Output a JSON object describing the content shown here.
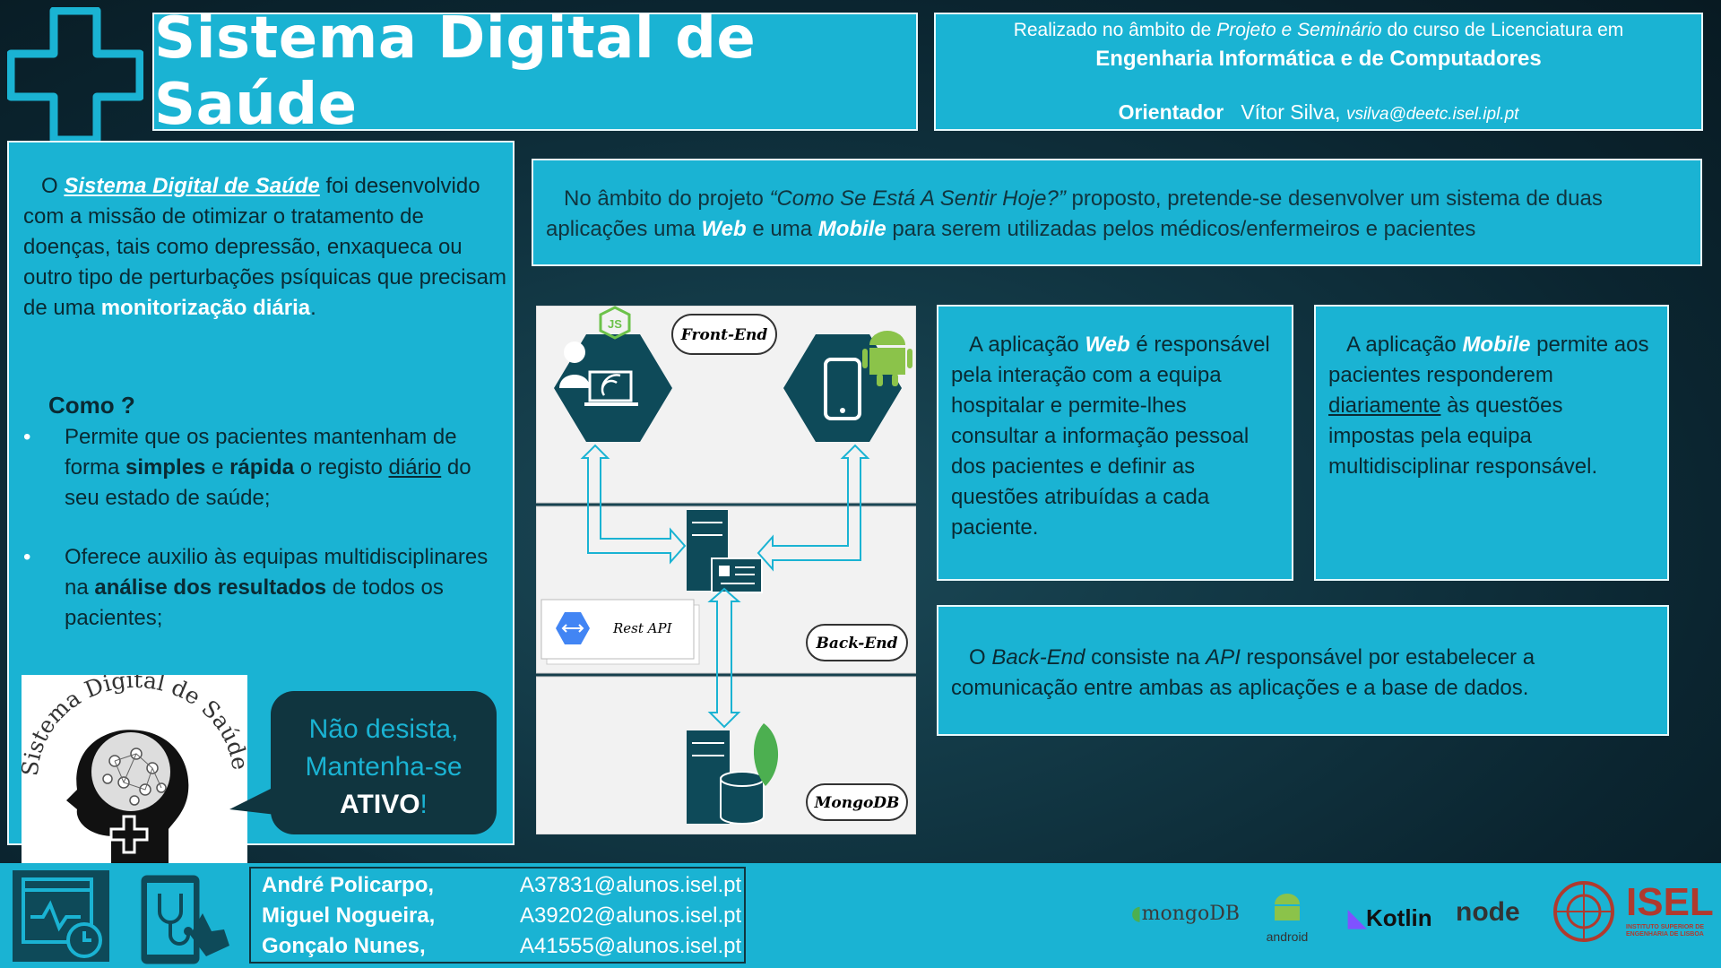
{
  "header": {
    "title": "Sistema Digital de Saúde",
    "info_prefix": "Realizado no âmbito de ",
    "info_course_italic": "Projeto e Seminário",
    "info_suffix": " do curso de Licenciatura em",
    "degree": "Engenharia Informática e de Computadores",
    "advisor_label": "Orientador",
    "advisor_name": "Vítor Silva,",
    "advisor_email": "vsilva@deetc.isel.ipl.pt"
  },
  "left": {
    "intro_pre": "O ",
    "intro_link": "Sistema Digital de Saúde",
    "intro_mid": " foi desenvolvido com a missão de otimizar o tratamento de doenças, tais como depressão, enxaqueca ou outro tipo de perturbações psíquicas que precisam de uma ",
    "intro_bold": "monitorização diária",
    "intro_end": ".",
    "como": "Como ?",
    "bullet_symbol": "•",
    "b1_a": "Permite que os pacientes mantenham de forma ",
    "b1_bold1": "simples",
    "b1_b": " e ",
    "b1_bold2": "rápida",
    "b1_c": " o registo ",
    "b1_under": "diário",
    "b1_d": " do seu estado de saúde;",
    "b2_a": "Oferece auxilio às equipas multidisciplinares na ",
    "b2_bold": "análise dos resultados",
    "b2_b": " de todos os pacientes;",
    "brain_caption": "Sistema Digital de Saúde",
    "bubble_l1": "Não desista,",
    "bubble_l2": "Mantenha-se",
    "bubble_bold": "ATIVO",
    "bubble_end": "!"
  },
  "project": {
    "pre": "No âmbito do projeto ",
    "italic": "“Como Se Está A Sentir Hoje?”",
    "mid": " proposto, pretende-se desenvolver um sistema de duas aplicações uma ",
    "web": "Web",
    "and": " e uma ",
    "mobile": "Mobile",
    "end": " para serem utilizadas pelos médicos/enfermeiros e pacientes"
  },
  "diagram": {
    "front_end": "Front-End",
    "back_end": "Back-End",
    "mongodb": "MongoDB",
    "rest_api": "Rest API",
    "js_badge": "JS"
  },
  "web_box": {
    "pre": "A aplicação ",
    "bold": "Web",
    "text": " é responsável pela interação com a equipa hospitalar e permite-lhes consultar a informação pessoal dos pacientes e definir as questões atribuídas a cada paciente."
  },
  "mobile_box": {
    "pre": "A aplicação ",
    "bold": "Mobile",
    "mid": " permite aos pacientes responderem ",
    "under": "diariamente",
    "end": " às questões impostas pela equipa multidisciplinar responsável."
  },
  "backend_box": {
    "pre": "O ",
    "it1": "Back-End",
    "mid": " consiste na ",
    "it2": "API",
    "end": " responsável por estabelecer a comunicação entre ambas as aplicações e a base de dados."
  },
  "footer": {
    "authors": [
      {
        "name": "André Policarpo,",
        "email": "A37831@alunos.isel.pt"
      },
      {
        "name": "Miguel Nogueira,",
        "email": "A39202@alunos.isel.pt"
      },
      {
        "name": "Gonçalo Nunes,",
        "email": "A41555@alunos.isel.pt"
      }
    ],
    "tech_mongodb": "mongoDB",
    "tech_android": "android",
    "tech_kotlin": "Kotlin",
    "tech_node": "node",
    "isel": "ISEL",
    "isel_sub": "INSTITUTO SUPERIOR DE ENGENHARIA DE LISBOA"
  },
  "colors": {
    "accent": "#1ab3d3",
    "dark": "#10353f",
    "background": "#0b2530"
  }
}
